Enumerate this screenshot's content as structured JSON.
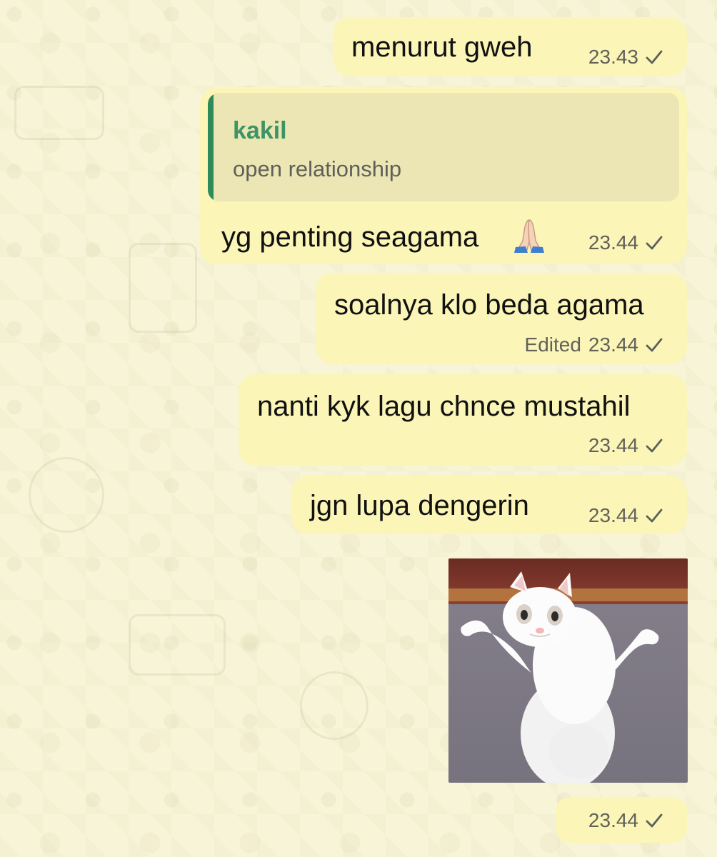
{
  "messages": [
    {
      "text": "menurut gweh",
      "time": "23.43"
    },
    {
      "reply_author": "kakil",
      "reply_text": "open relationship",
      "text": "yg penting seagama",
      "time": "23.44"
    },
    {
      "text": "soalnya klo beda agama",
      "edited_label": "Edited",
      "time": "23.44"
    },
    {
      "text": "nanti kyk lagu chnce mustahil",
      "time": "23.44"
    },
    {
      "text": "jgn lupa dengerin",
      "time": "23.44"
    },
    {
      "media_type": "cat-photo",
      "time": "23.44"
    }
  ],
  "icons": {
    "read_status": "single-check-icon",
    "reply_emoji": "folded-hands-emoji"
  },
  "colors": {
    "bubble": "#fbf5b7",
    "reply_accent": "#2d8b59",
    "background": "#f8f4d8"
  }
}
